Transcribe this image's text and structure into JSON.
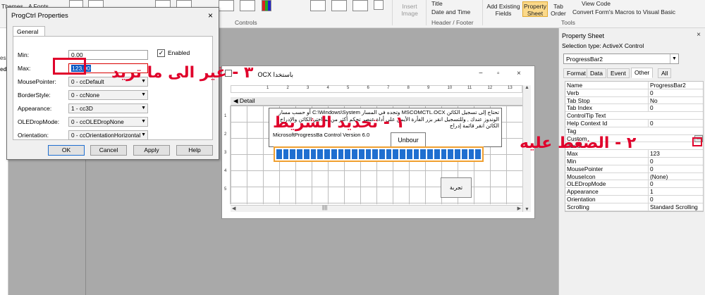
{
  "ribbon": {
    "themes": "Themes",
    "fonts": "A Fonts",
    "controls": "Controls",
    "insert_image": "Insert Image",
    "date_time": "Date and Time",
    "header_footer": "Header / Footer",
    "add_existing_fields": "Add Existing Fields",
    "property_sheet": "Property Sheet",
    "tab_order": "Tab Order",
    "view_code": "View Code",
    "convert_macros": "Convert Form's Macros to Visual Basic",
    "tools": "Tools",
    "title_partial": "Title"
  },
  "nav": {
    "text_partial": "es",
    "text2_partial": "ed"
  },
  "dialog": {
    "title": "ProgCtrl Properties",
    "close": "×",
    "tab": "General",
    "fields": {
      "min_label": "Min:",
      "min_value": "0.00",
      "max_label": "Max:",
      "max_value": "123.00",
      "mouse_label": "MousePointer:",
      "mouse_value": "0 - ccDefault",
      "border_label": "BorderStyle:",
      "border_value": "0 - ccNone",
      "appearance_label": "Appearance:",
      "appearance_value": "1 - cc3D",
      "ole_label": "OLEDropMode:",
      "ole_value": "0 - ccOLEDropNone",
      "orientation_label": "Orientation:",
      "orientation_value": "0 - ccOrientationHorizontal"
    },
    "enabled_label": "Enabled",
    "enabled_checked": true,
    "buttons": {
      "ok": "OK",
      "cancel": "Cancel",
      "apply": "Apply",
      "help": "Help"
    }
  },
  "form_window": {
    "title": "باستخدا OCX",
    "detail": "Detail",
    "label_text": "تحتاج إلى تسجيل الكائن MSCOMCTL.OCX وتجده في المسار C:\\Windows\\System أو حسب مسار الوندوز عندك , وللتسجيل انقر بزر الفأرة الأيمن على أداة عنصر تحكم أكثر من ثم اختر الكائن والإدراج الكائن انقر قائمة إدراج",
    "label_ltr": "MicrosoftProgressBa Control  Version 6.0",
    "unbound": "Unbour",
    "test_button": "تجربة",
    "progress_fraction": 1.0,
    "ruler_marks": [
      "1",
      "2",
      "3",
      "4",
      "5",
      "6",
      "7",
      "8",
      "9",
      "10",
      "11",
      "12",
      "13"
    ],
    "v_ruler_marks": [
      "1",
      "2",
      "3",
      "4",
      "5"
    ]
  },
  "property_sheet": {
    "title": "Property Sheet",
    "selection_type": "Selection type:  ActiveX Control",
    "selected_object": "ProgressBar2",
    "tabs": [
      "Format",
      "Data",
      "Event",
      "Other",
      "All"
    ],
    "active_tab": "Other",
    "rows": [
      {
        "k": "Name",
        "v": "ProgressBar2"
      },
      {
        "k": "Verb",
        "v": "0"
      },
      {
        "k": "Tab Stop",
        "v": "No"
      },
      {
        "k": "Tab Index",
        "v": "0"
      },
      {
        "k": "ControlTip Text",
        "v": ""
      },
      {
        "k": "Help Context Id",
        "v": "0"
      },
      {
        "k": "Tag",
        "v": ""
      },
      {
        "k": "Custom",
        "v": ""
      },
      {
        "k": "About",
        "v": ""
      },
      {
        "k": "Max",
        "v": "123"
      },
      {
        "k": "Min",
        "v": "0"
      },
      {
        "k": "MousePointer",
        "v": "0"
      },
      {
        "k": "MouseIcon",
        "v": "(None)"
      },
      {
        "k": "OLEDropMode",
        "v": "0"
      },
      {
        "k": "Appearance",
        "v": "1"
      },
      {
        "k": "Orientation",
        "v": "0"
      },
      {
        "k": "Scrolling",
        "v": "Standard Scrolling"
      }
    ],
    "ellipsis": "..."
  },
  "annotations": {
    "step1": "١ - تحديد الشريط",
    "step2": "٢ - الضغط عليه",
    "step3": "٣ - غير الى ما تريد"
  },
  "colors": {
    "annotation": "#e0002b",
    "progress": "#1f6fd0",
    "selection_outline": "#f0a030"
  }
}
